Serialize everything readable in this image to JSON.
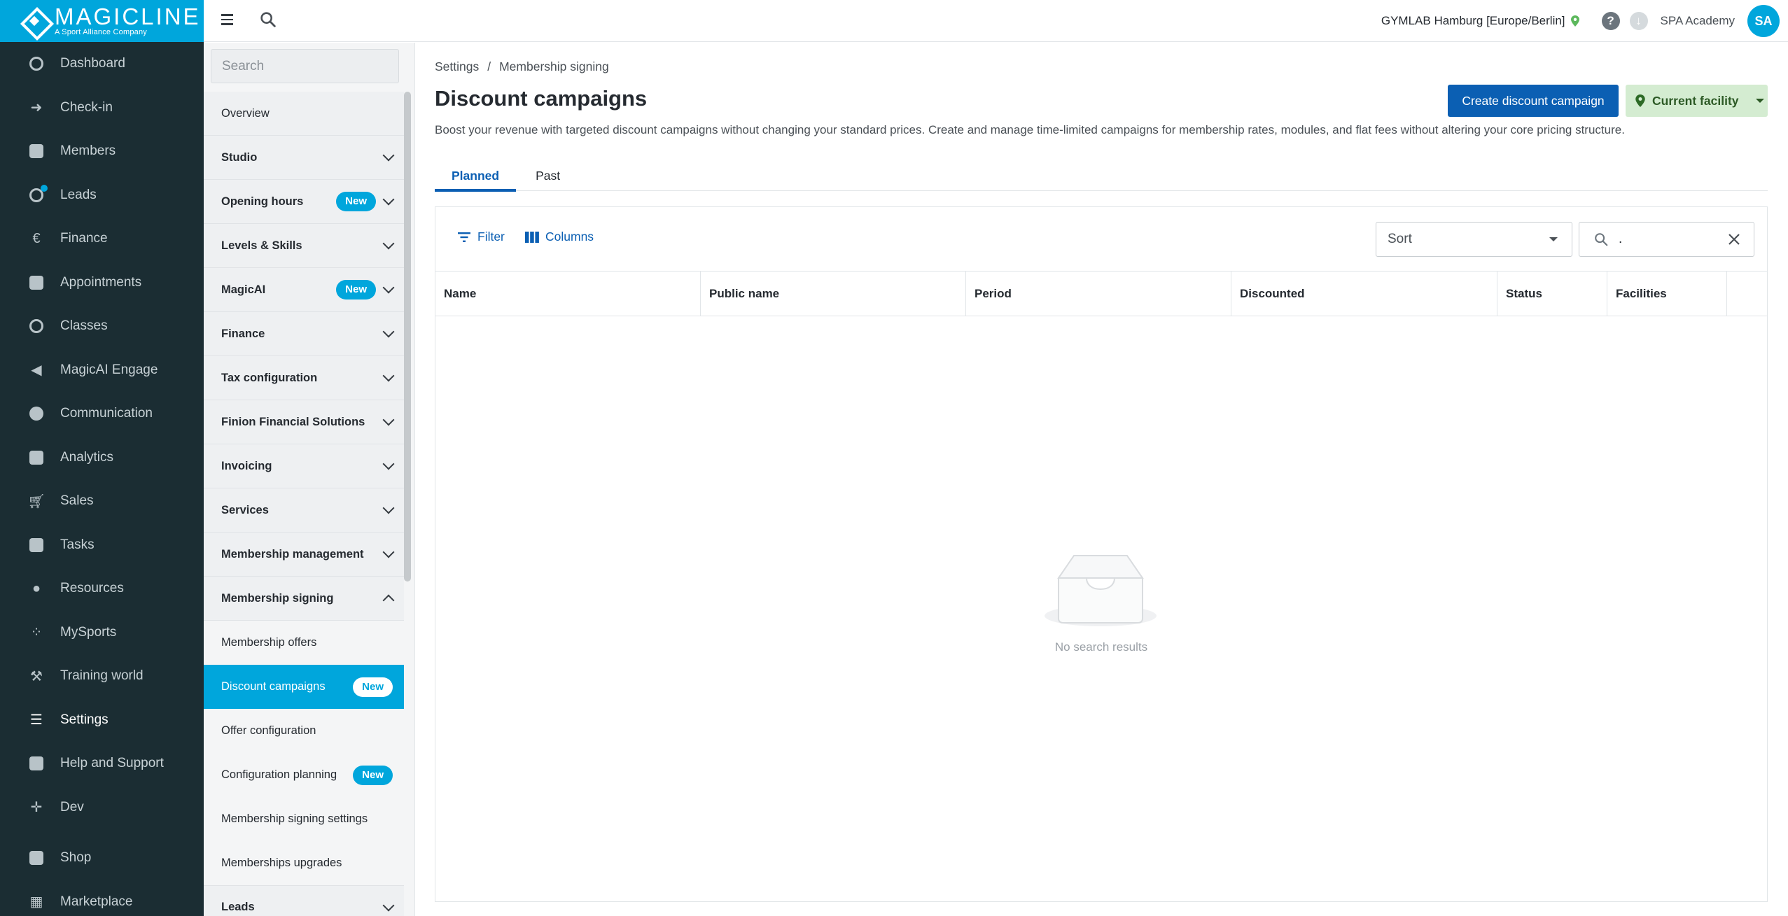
{
  "brand": {
    "name": "MAGICLINE",
    "tagline": "A Sport Alliance Company",
    "accent": "#00a6dc",
    "nav_bg": "#1b2d33",
    "primary": "#0b5fb3"
  },
  "nav": {
    "items": [
      {
        "label": "Dashboard",
        "icon": "dashboard-icon"
      },
      {
        "label": "Check-in",
        "icon": "check-in-icon"
      },
      {
        "label": "Members",
        "icon": "members-icon"
      },
      {
        "label": "Leads",
        "icon": "leads-icon"
      },
      {
        "label": "Finance",
        "icon": "finance-icon"
      },
      {
        "label": "Appointments",
        "icon": "calendar-icon"
      },
      {
        "label": "Classes",
        "icon": "classes-icon"
      },
      {
        "label": "MagicAI Engage",
        "icon": "megaphone-icon"
      },
      {
        "label": "Communication",
        "icon": "chat-icon"
      },
      {
        "label": "Analytics",
        "icon": "analytics-icon"
      },
      {
        "label": "Sales",
        "icon": "cart-icon"
      },
      {
        "label": "Tasks",
        "icon": "tasks-icon"
      },
      {
        "label": "Resources",
        "icon": "resources-icon"
      },
      {
        "label": "MySports",
        "icon": "mysports-icon"
      },
      {
        "label": "Training world",
        "icon": "dumbbell-icon"
      },
      {
        "label": "Settings",
        "icon": "sliders-icon"
      },
      {
        "label": "Help and Support",
        "icon": "help-icon"
      },
      {
        "label": "Dev",
        "icon": "dev-icon"
      },
      {
        "label": "Shop",
        "icon": "shop-icon"
      },
      {
        "label": "Marketplace",
        "icon": "marketplace-icon"
      }
    ]
  },
  "topbar": {
    "facility": "GYMLAB Hamburg [Europe/Berlin]",
    "help": "?",
    "download": "↓",
    "account": "SPA Academy",
    "avatar": "SA"
  },
  "subnav": {
    "search_placeholder": "Search",
    "items": [
      {
        "label": "Overview"
      },
      {
        "label": "Studio"
      },
      {
        "label": "Opening hours",
        "badge": "New"
      },
      {
        "label": "Levels & Skills"
      },
      {
        "label": "MagicAI",
        "badge": "New"
      },
      {
        "label": "Finance"
      },
      {
        "label": "Tax configuration"
      },
      {
        "label": "Finion Financial Solutions"
      },
      {
        "label": "Invoicing"
      },
      {
        "label": "Services"
      },
      {
        "label": "Membership management"
      },
      {
        "label": "Membership signing"
      },
      {
        "label": "Membership offers"
      },
      {
        "label": "Discount campaigns",
        "badge": "New"
      },
      {
        "label": "Offer configuration"
      },
      {
        "label": "Configuration planning",
        "badge": "New"
      },
      {
        "label": "Membership signing settings"
      },
      {
        "label": "Memberships upgrades"
      },
      {
        "label": "Leads"
      }
    ]
  },
  "breadcrumb": {
    "root": "Settings",
    "sep": "/",
    "current": "Membership signing"
  },
  "page": {
    "title": "Discount campaigns",
    "description": "Boost your revenue with targeted discount campaigns without changing your standard prices. Create and manage time-limited campaigns for membership rates, modules, and flat fees without altering your core pricing structure.",
    "create_label": "Create discount campaign",
    "facility_label": "Current facility"
  },
  "tabs": [
    {
      "label": "Planned"
    },
    {
      "label": "Past"
    }
  ],
  "table": {
    "filter_label": "Filter",
    "columns_label": "Columns",
    "sort_label": "Sort",
    "search_value": ".",
    "columns": [
      "Name",
      "Public name",
      "Period",
      "Discounted",
      "Status",
      "Facilities"
    ],
    "empty_text": "No search results"
  }
}
